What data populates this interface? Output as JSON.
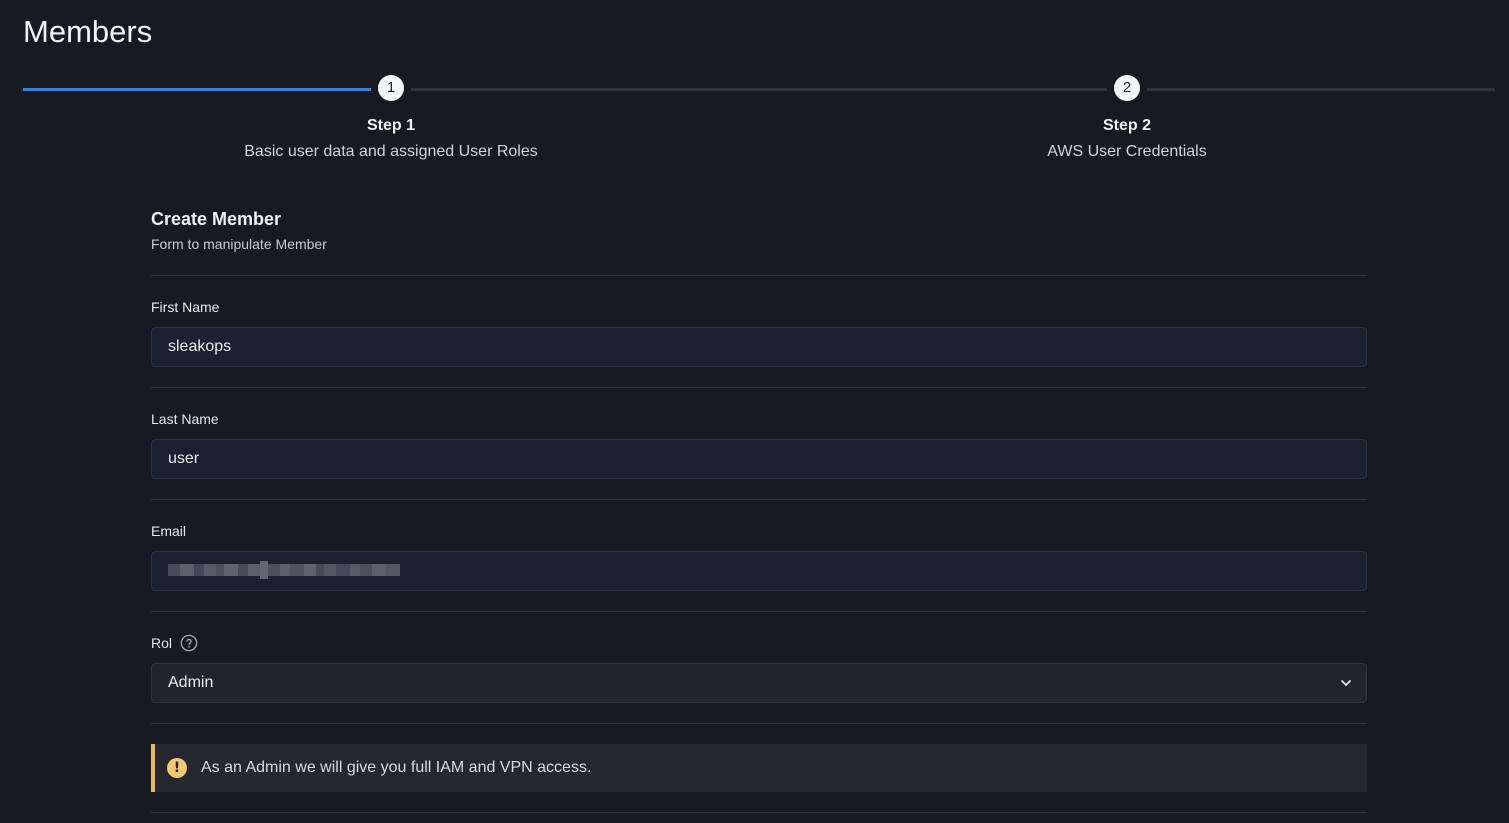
{
  "page": {
    "title": "Members"
  },
  "stepper": {
    "steps": [
      {
        "number": "1",
        "title": "Step 1",
        "description": "Basic user data and assigned User Roles"
      },
      {
        "number": "2",
        "title": "Step 2",
        "description": "AWS User Credentials"
      }
    ],
    "active_color": "#3a82d2"
  },
  "form": {
    "title": "Create Member",
    "subtitle": "Form to manipulate Member",
    "first_name": {
      "label": "First Name",
      "value": "sleakops"
    },
    "last_name": {
      "label": "Last Name",
      "value": "user"
    },
    "email": {
      "label": "Email",
      "value": ""
    },
    "role": {
      "label": "Rol",
      "value": "Admin",
      "help_icon": "question-circle-icon"
    },
    "alert": {
      "text": "As an Admin we will give you full IAM and VPN access.",
      "color": "#e8b868"
    }
  }
}
